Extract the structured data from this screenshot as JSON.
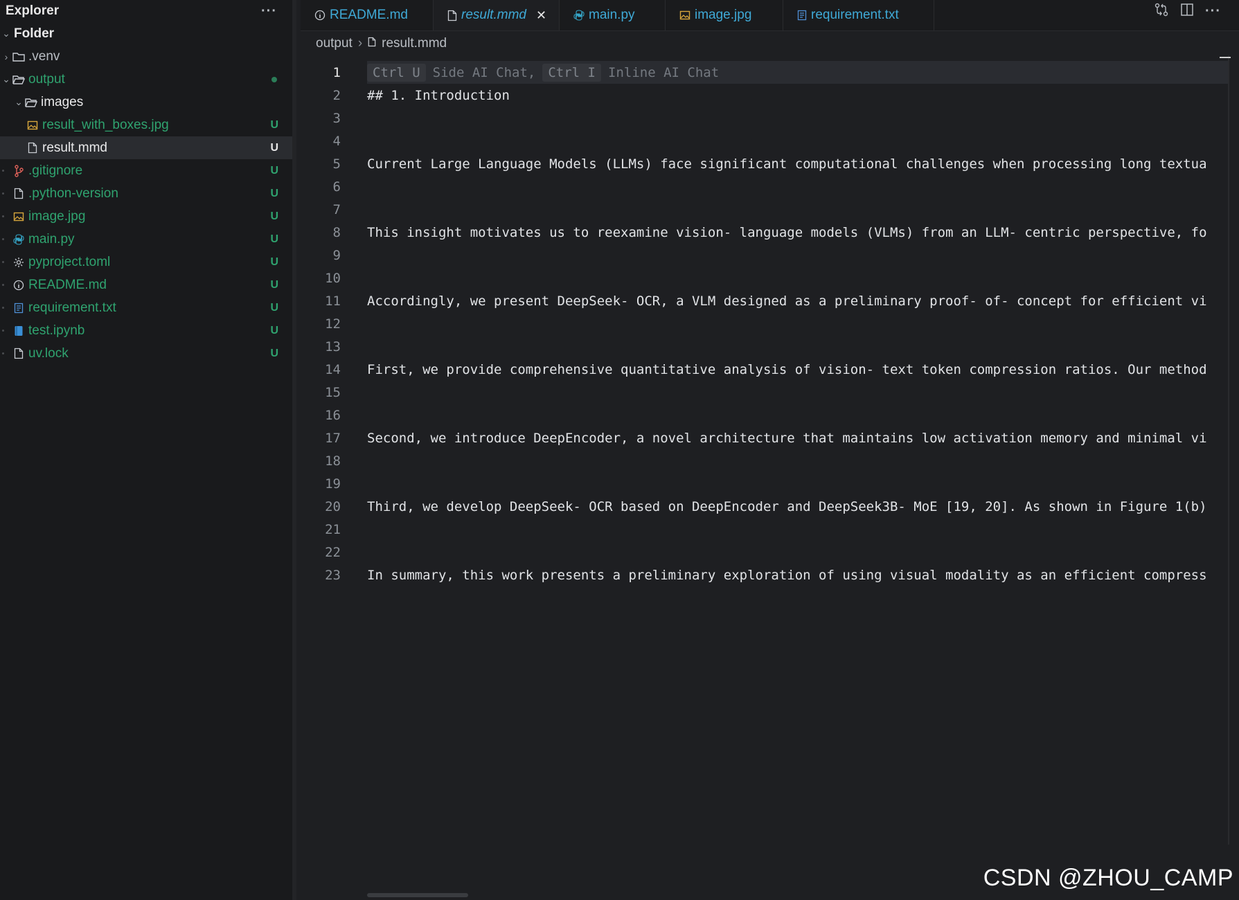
{
  "sidebar": {
    "title": "Explorer",
    "more": "···",
    "root": "Folder",
    "items": [
      {
        "label": ".venv",
        "badge": "",
        "icon": "folder-icon"
      },
      {
        "label": "output",
        "badge": "",
        "icon": "folder-open-icon"
      },
      {
        "label": "images",
        "badge": "",
        "icon": "folder-open-icon"
      },
      {
        "label": "result_with_boxes.jpg",
        "badge": "U",
        "icon": "image-file-icon"
      },
      {
        "label": "result.mmd",
        "badge": "U",
        "icon": "file-icon"
      },
      {
        "label": ".gitignore",
        "badge": "U",
        "icon": "git-icon"
      },
      {
        "label": ".python-version",
        "badge": "U",
        "icon": "file-icon"
      },
      {
        "label": "image.jpg",
        "badge": "U",
        "icon": "image-file-icon"
      },
      {
        "label": "main.py",
        "badge": "U",
        "icon": "python-icon"
      },
      {
        "label": "pyproject.toml",
        "badge": "U",
        "icon": "gear-icon"
      },
      {
        "label": "README.md",
        "badge": "U",
        "icon": "info-icon"
      },
      {
        "label": "requirement.txt",
        "badge": "U",
        "icon": "text-file-icon"
      },
      {
        "label": "test.ipynb",
        "badge": "U",
        "icon": "notebook-icon"
      },
      {
        "label": "uv.lock",
        "badge": "U",
        "icon": "file-icon"
      }
    ]
  },
  "tabs": [
    {
      "label": "README.md",
      "icon": "info-icon"
    },
    {
      "label": "result.mmd",
      "icon": "file-icon",
      "close": "✕"
    },
    {
      "label": "main.py",
      "icon": "python-icon"
    },
    {
      "label": "image.jpg",
      "icon": "image-file-icon"
    },
    {
      "label": "requirement.txt",
      "icon": "text-file-icon"
    }
  ],
  "breadcrumb": {
    "folder": "output",
    "sep": "›",
    "file": "result.mmd"
  },
  "hint": {
    "key1": "Ctrl U",
    "label1": "Side AI Chat,",
    "key2": "Ctrl I",
    "label2": "Inline AI Chat"
  },
  "lines": [
    {
      "n": "1",
      "text": ""
    },
    {
      "n": "2",
      "text": "## 1. Introduction"
    },
    {
      "n": "3",
      "text": ""
    },
    {
      "n": "4",
      "text": ""
    },
    {
      "n": "5",
      "text": "Current Large Language Models (LLMs) face significant computational challenges when processing long textua"
    },
    {
      "n": "6",
      "text": ""
    },
    {
      "n": "7",
      "text": ""
    },
    {
      "n": "8",
      "text": "This insight motivates us to reexamine vision- language models (VLMs) from an LLM- centric perspective, fo"
    },
    {
      "n": "9",
      "text": ""
    },
    {
      "n": "10",
      "text": ""
    },
    {
      "n": "11",
      "text": "Accordingly, we present DeepSeek- OCR, a VLM designed as a preliminary proof- of- concept for efficient vi"
    },
    {
      "n": "12",
      "text": ""
    },
    {
      "n": "13",
      "text": ""
    },
    {
      "n": "14",
      "text": "First, we provide comprehensive quantitative analysis of vision- text token compression ratios. Our method"
    },
    {
      "n": "15",
      "text": ""
    },
    {
      "n": "16",
      "text": ""
    },
    {
      "n": "17",
      "text": "Second, we introduce DeepEncoder, a novel architecture that maintains low activation memory and minimal vi"
    },
    {
      "n": "18",
      "text": ""
    },
    {
      "n": "19",
      "text": ""
    },
    {
      "n": "20",
      "text": "Third, we develop DeepSeek- OCR based on DeepEncoder and DeepSeek3B- MoE [19, 20]. As shown in Figure 1(b)"
    },
    {
      "n": "21",
      "text": ""
    },
    {
      "n": "22",
      "text": ""
    },
    {
      "n": "23",
      "text": "In summary, this work presents a preliminary exploration of using visual modality as an efficient compress"
    }
  ],
  "watermark": "CSDN @ZHOU_CAMP"
}
